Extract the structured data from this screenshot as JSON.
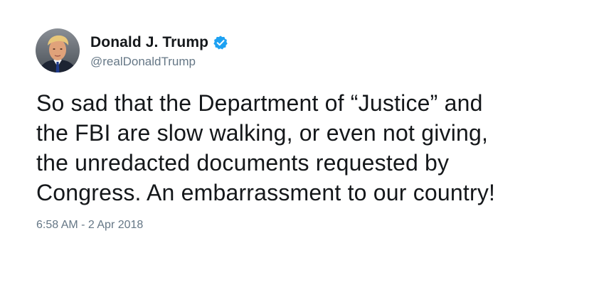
{
  "user": {
    "display_name": "Donald J. Trump",
    "handle": "@realDonaldTrump",
    "verified": true,
    "verified_color": "#1da1f2"
  },
  "tweet": {
    "lines": [
      "So sad that the Department of “Justice” and",
      "the FBI are slow walking, or even not giving,",
      "the unredacted documents requested by",
      "Congress. An embarrassment to our country!"
    ],
    "timestamp": "6:58 AM - 2 Apr 2018"
  },
  "icons": {
    "avatar": "profile-photo",
    "verified": "verified-badge-icon"
  }
}
